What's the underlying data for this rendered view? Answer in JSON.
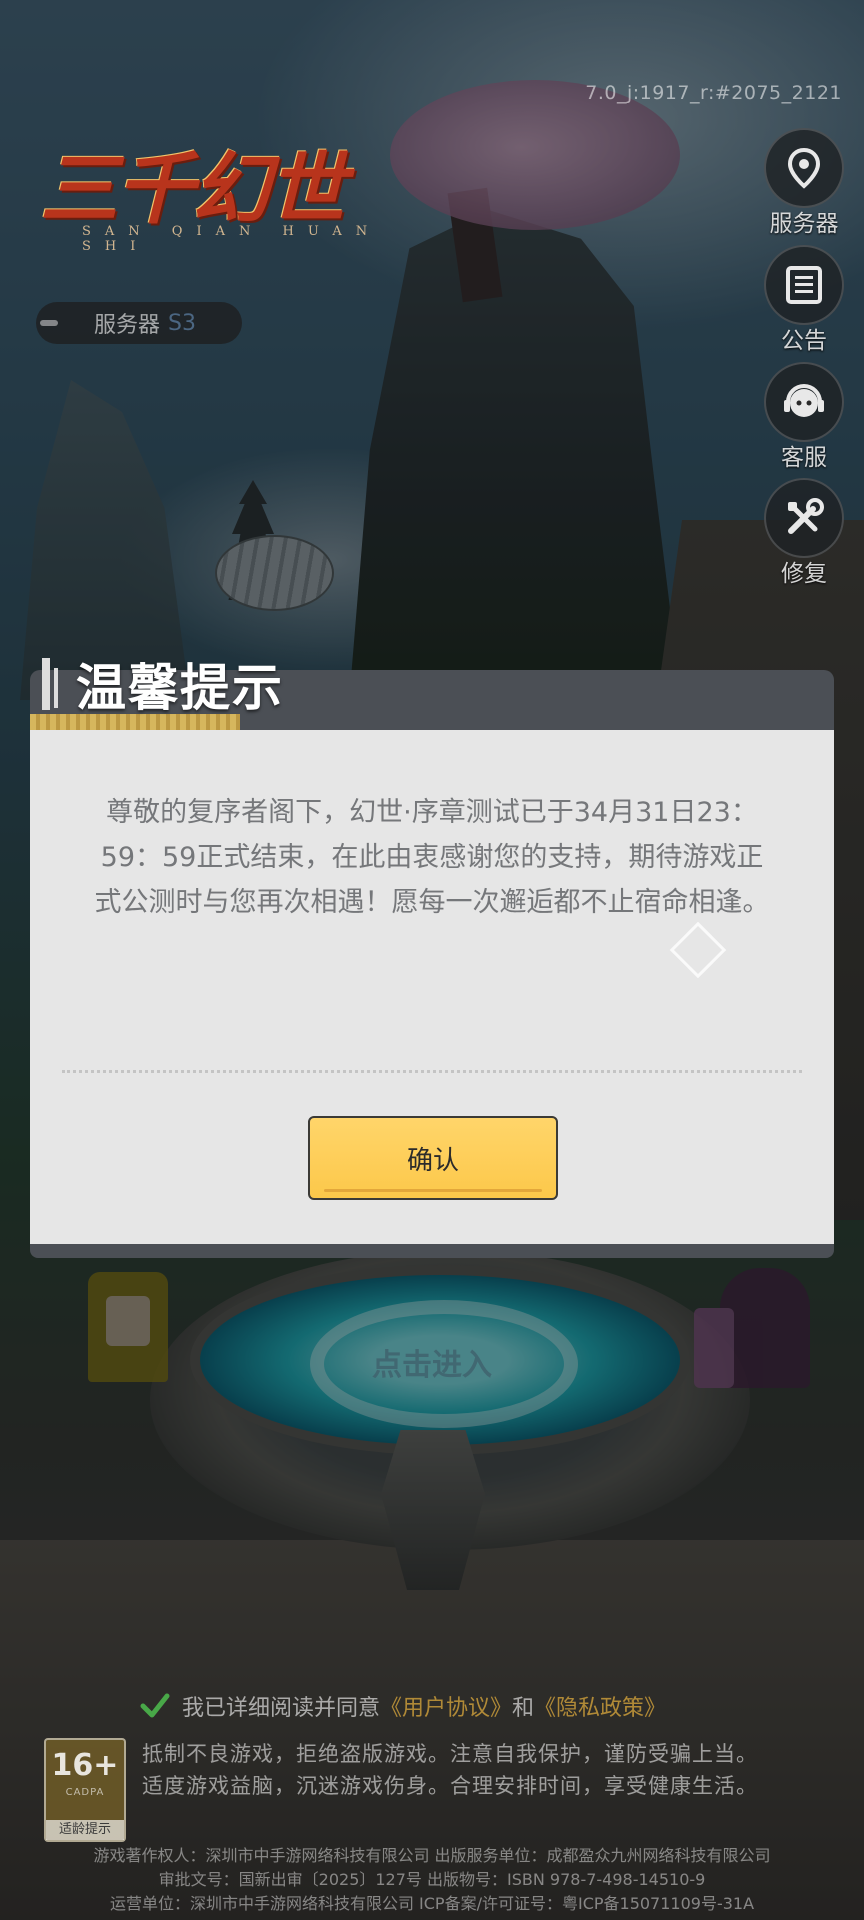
{
  "version": "7.0_j:1917_r:#2075_2121",
  "logo": {
    "title": "三千幻世",
    "subtitle": "SAN QIAN HUAN SHI"
  },
  "server_chip": {
    "label": "服务器",
    "code": "S3"
  },
  "side_menu": [
    {
      "label": "服务器",
      "icon": "map-pin-icon"
    },
    {
      "label": "公告",
      "icon": "list-icon"
    },
    {
      "label": "客服",
      "icon": "headset-icon"
    },
    {
      "label": "修复",
      "icon": "tools-icon"
    }
  ],
  "dialog": {
    "title": "温馨提示",
    "message": "尊敬的复序者阁下，幻世·序章测试已于34月31日23：59：59正式结束，在此由衷感谢您的支持，期待游戏正式公测时与您再次相遇！愿每一次邂逅都不止宿命相逢。",
    "confirm_label": "确认",
    "accent_color": "#fcc84a"
  },
  "enter_label": "点击进入",
  "agreement": {
    "prefix": "我已详细阅读并同意",
    "user_agreement": "《用户协议》",
    "and": "和",
    "privacy_policy": "《隐私政策》"
  },
  "age_rating": {
    "number": "16+",
    "org": "CADPA",
    "tip": "适龄提示"
  },
  "health_notice": [
    "抵制不良游戏，拒绝盗版游戏。注意自我保护，谨防受骗上当。",
    "适度游戏益脑，沉迷游戏伤身。合理安排时间，享受健康生活。"
  ],
  "legal": [
    "游戏著作权人：深圳市中手游网络科技有限公司 出版服务单位：成都盈众九州网络科技有限公司",
    "审批文号：国新出审〔2025〕127号 出版物号：ISBN 978-7-498-14510-9",
    "运营单位：深圳市中手游网络科技有限公司 ICP备案/许可证号：粤ICP备15071109号-31A"
  ]
}
